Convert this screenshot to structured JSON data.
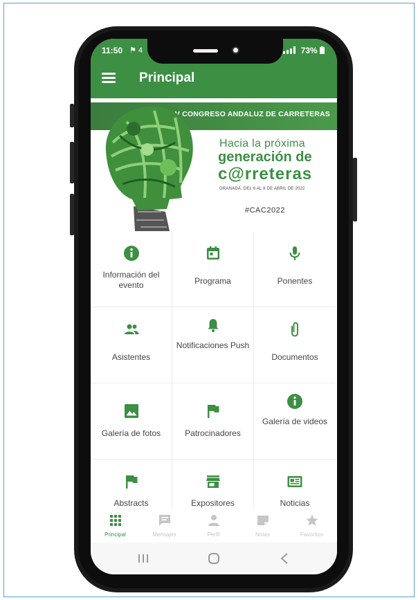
{
  "status_bar": {
    "time": "11:50",
    "indicators": "⚑ 4",
    "battery": "73%"
  },
  "app_bar": {
    "title": "Principal"
  },
  "banner": {
    "event_name": "V CONGRESO ANDALUZ DE CARRETERAS",
    "tagline_line1": "Hacia la próxima",
    "tagline_line2": "generación de",
    "tagline_line3": "c@rreteras",
    "dates": "GRANADA, DEL 6 AL 8 DE ABRIL DE 2022",
    "hashtag": "#CAC2022"
  },
  "menu_grid": [
    {
      "label": "Información del evento",
      "icon": "info-icon"
    },
    {
      "label": "Programa",
      "icon": "calendar-icon"
    },
    {
      "label": "Ponentes",
      "icon": "microphone-icon"
    },
    {
      "label": "Asistentes",
      "icon": "people-icon"
    },
    {
      "label": "Notificaciones Push",
      "icon": "bell-icon"
    },
    {
      "label": "Documentos",
      "icon": "paperclip-icon"
    },
    {
      "label": "Galería de fotos",
      "icon": "image-icon"
    },
    {
      "label": "Patrocinadores",
      "icon": "flag-icon"
    },
    {
      "label": "Galería de videos",
      "icon": "info-icon"
    },
    {
      "label": "Abstracts",
      "icon": "flag-icon"
    },
    {
      "label": "Expositores",
      "icon": "store-icon"
    },
    {
      "label": "Noticias",
      "icon": "newspaper-icon"
    }
  ],
  "bottom_nav": [
    {
      "label": "Principal",
      "icon": "grid-icon",
      "active": true
    },
    {
      "label": "Mensajes",
      "icon": "chat-icon",
      "active": false
    },
    {
      "label": "Perfil",
      "icon": "person-icon",
      "active": false
    },
    {
      "label": "Notas",
      "icon": "note-icon",
      "active": false
    },
    {
      "label": "Favoritos",
      "icon": "star-icon",
      "active": false
    }
  ],
  "system_nav": [
    "recents-icon",
    "home-icon",
    "back-icon"
  ],
  "colors": {
    "primary": "#3c8f43",
    "label_text": "#444444",
    "inactive_nav": "#c6c6c6"
  }
}
